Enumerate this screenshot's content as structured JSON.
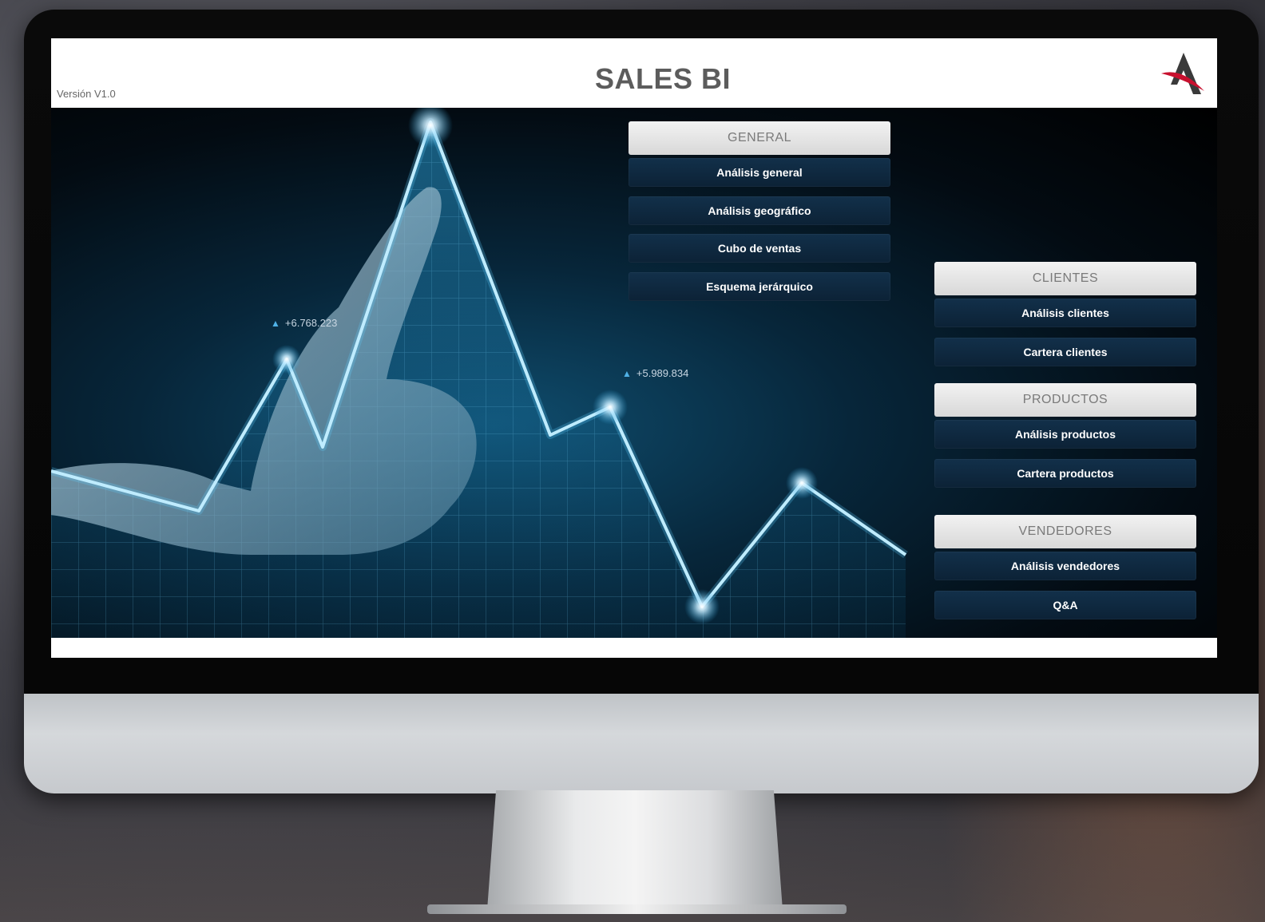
{
  "app": {
    "version": "Versión V1.0",
    "title": "SALES BI"
  },
  "deltas": [
    "+6.768.223",
    "+5.989.834"
  ],
  "menu": {
    "general": {
      "header": "GENERAL",
      "items": [
        "Análisis general",
        "Análisis geográfico",
        "Cubo de ventas",
        "Esquema jerárquico"
      ]
    },
    "clientes": {
      "header": "CLIENTES",
      "items": [
        "Análisis clientes",
        "Cartera clientes"
      ]
    },
    "productos": {
      "header": "PRODUCTOS",
      "items": [
        "Análisis productos",
        "Cartera productos"
      ]
    },
    "vendedores": {
      "header": "VENDEDORES",
      "items": [
        "Análisis vendedores",
        "Q&A"
      ]
    }
  },
  "colors": {
    "menu_button": "#0f2a41",
    "menu_header": "#dcdcdc",
    "title": "#5c5c5c",
    "logo_red": "#c8102e"
  }
}
